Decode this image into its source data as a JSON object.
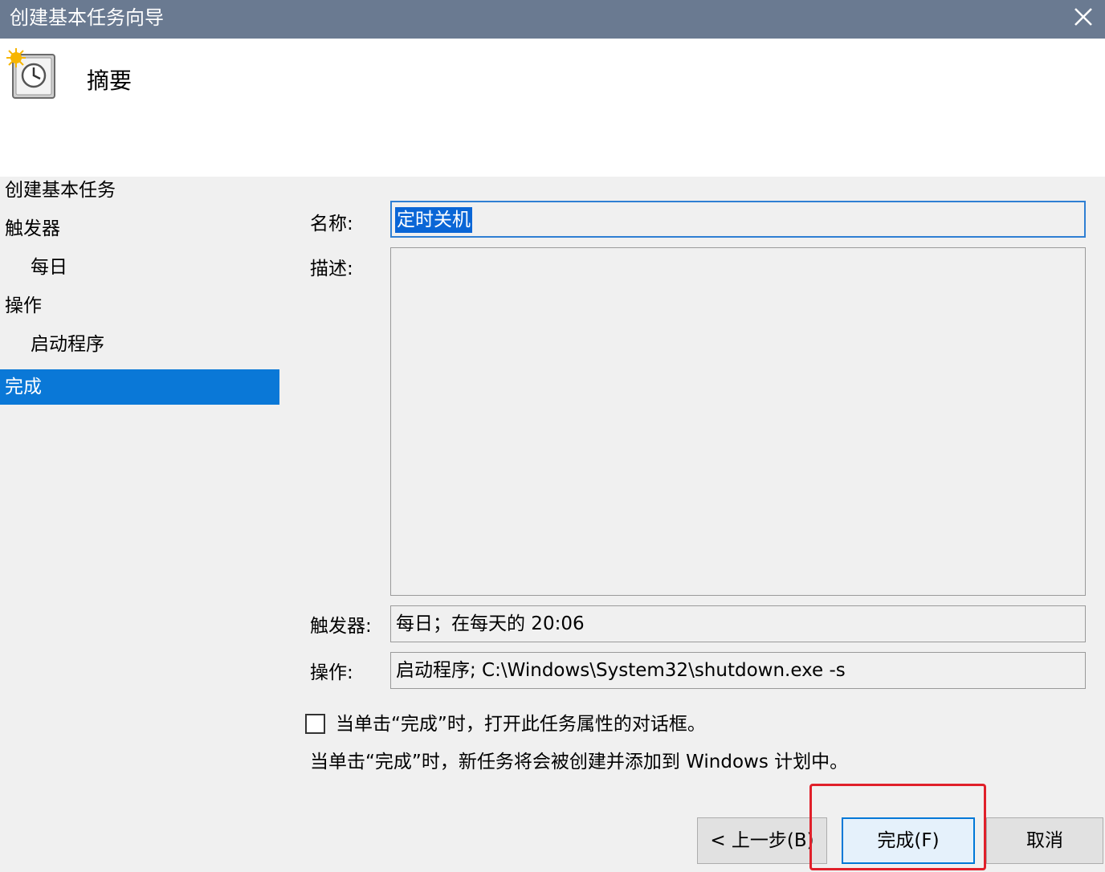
{
  "window": {
    "title": "创建基本任务向导"
  },
  "header": {
    "heading": "摘要",
    "icon": "task-scheduler-clock-icon"
  },
  "sidebar": {
    "items": [
      {
        "label": "创建基本任务"
      },
      {
        "label": "触发器"
      },
      {
        "label": "每日"
      },
      {
        "label": "操作"
      },
      {
        "label": "启动程序"
      },
      {
        "label": "完成"
      }
    ],
    "active_color": "#0a78d7"
  },
  "form": {
    "name_label": "名称:",
    "name_value": "定时关机",
    "description_label": "描述:",
    "description_value": "",
    "trigger_label": "触发器:",
    "trigger_value": "每日；在每天的 20:06",
    "action_label": "操作:",
    "action_value": "启动程序; C:\\Windows\\System32\\shutdown.exe -s",
    "checkbox_label": "当单击“完成”时，打开此任务属性的对话框。",
    "checkbox_checked": false,
    "info_text": "当单击“完成”时，新任务将会被创建并添加到 Windows 计划中。"
  },
  "buttons": {
    "back_label": "< 上一步(B)",
    "finish_label": "完成(F)",
    "cancel_label": "取消"
  },
  "annotation": {
    "color": "#e0202a"
  }
}
